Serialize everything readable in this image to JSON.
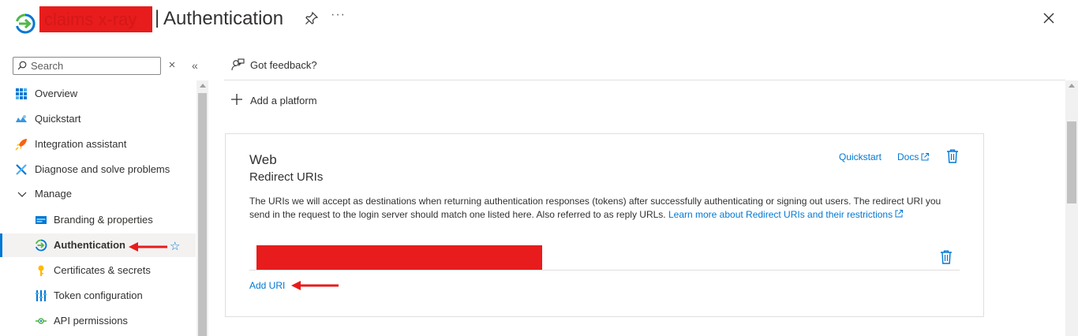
{
  "header": {
    "app_name": "claims x-ray",
    "separator": "|",
    "title": "Authentication",
    "more_label": "···"
  },
  "sidebar": {
    "search": {
      "placeholder": "Search",
      "value": ""
    },
    "collapse_label": "«",
    "items": [
      {
        "label": "Overview",
        "icon": "overview-grid-icon"
      },
      {
        "label": "Quickstart",
        "icon": "quickstart-cloud-icon"
      },
      {
        "label": "Integration assistant",
        "icon": "rocket-icon"
      },
      {
        "label": "Diagnose and solve problems",
        "icon": "wrench-icon"
      },
      {
        "label": "Manage",
        "icon": "chevron-down-icon",
        "expanded": true
      },
      {
        "label": "Branding & properties",
        "icon": "branding-icon"
      },
      {
        "label": "Authentication",
        "icon": "authentication-icon",
        "active": true
      },
      {
        "label": "Certificates & secrets",
        "icon": "key-icon"
      },
      {
        "label": "Token configuration",
        "icon": "token-bars-icon"
      },
      {
        "label": "API permissions",
        "icon": "api-permissions-icon"
      }
    ],
    "favorite_icon": "☆"
  },
  "toolbar": {
    "feedback_label": "Got feedback?"
  },
  "main": {
    "add_platform_label": "Add a platform",
    "card": {
      "title": "Web",
      "subtitle": "Redirect URIs",
      "quickstart_label": "Quickstart",
      "docs_label": "Docs",
      "description": "The URIs we will accept as destinations when returning authentication responses (tokens) after successfully authenticating or signing out users. The redirect URI you send in the request to the login server should match one listed here. Also referred to as reply URLs.",
      "learn_more_label": "Learn more about Redirect URIs and their restrictions",
      "uri_value": "",
      "add_uri_label": "Add URI"
    }
  },
  "colors": {
    "accent": "#0078d4",
    "redaction": "#e81c1c",
    "text": "#323130",
    "border": "#e1dfdd"
  }
}
